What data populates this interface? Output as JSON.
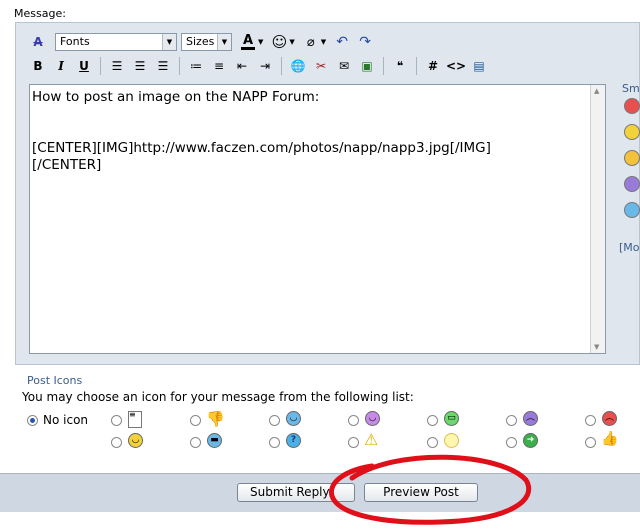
{
  "message_label": "Message:",
  "toolbar": {
    "font_select": "Fonts",
    "size_select": "Sizes",
    "font_color_glyph": "A",
    "bold": "B",
    "italic": "I",
    "underline": "U",
    "hash": "#",
    "code": "<>"
  },
  "editor": {
    "text": "How to post an image on the NAPP Forum:\n\n\n[CENTER][IMG]http://www.faczen.com/photos/napp/napp3.jpg[/IMG]\n[/CENTER]"
  },
  "smilies_panel": {
    "title": "Sm",
    "more": "[Mo"
  },
  "post_icons": {
    "title": "Post Icons",
    "description": "You may choose an icon for your message from the following list:",
    "no_icon_label": "No icon"
  },
  "buttons": {
    "submit": "Submit Reply",
    "preview": "Preview Post"
  },
  "colors": {
    "panel_bg": "#dfe6ee",
    "bottom_bar": "#cfd8e2",
    "annotation": "#e0101a",
    "link": "#3a5d8a"
  }
}
